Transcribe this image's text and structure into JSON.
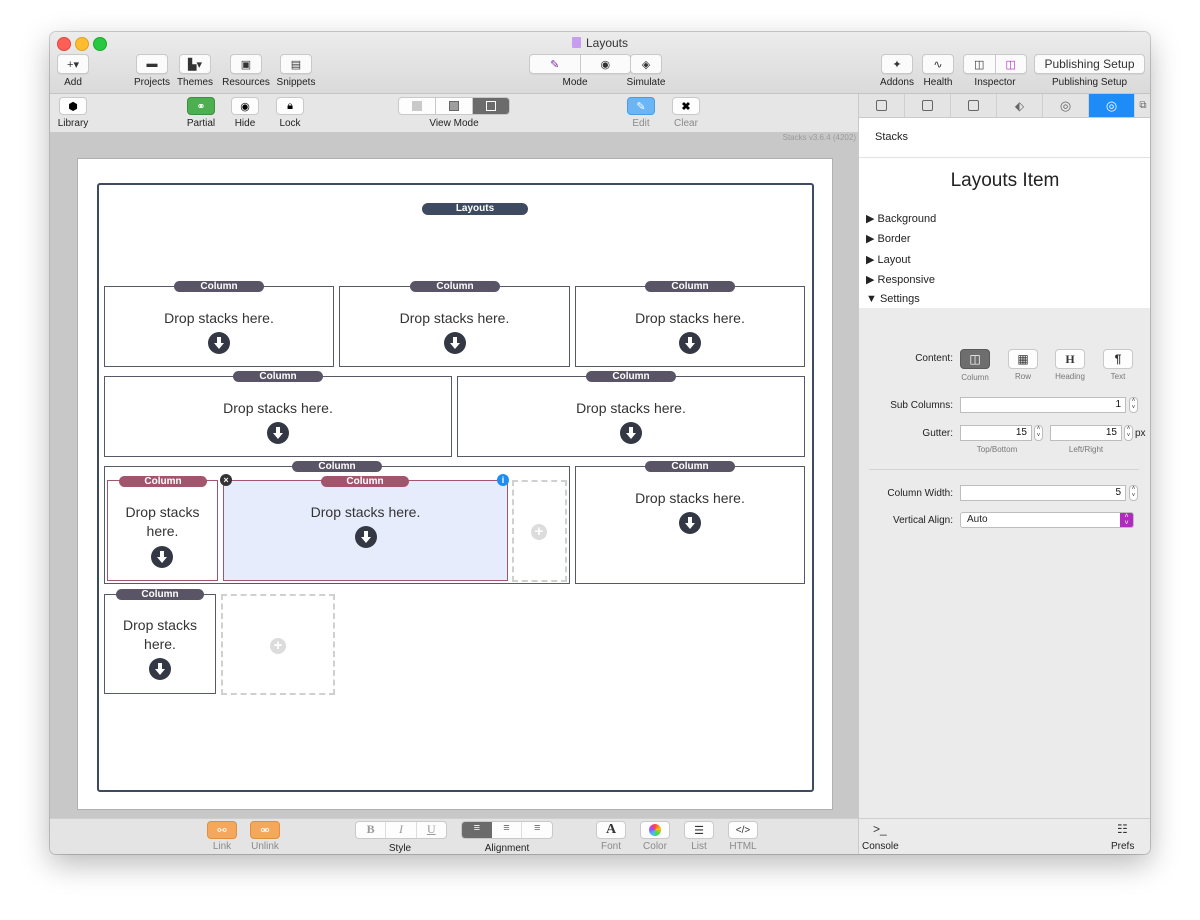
{
  "window": {
    "title": "Layouts"
  },
  "toolbar": {
    "add": "Add",
    "projects": "Projects",
    "themes": "Themes",
    "resources": "Resources",
    "snippets": "Snippets",
    "mode": "Mode",
    "simulate": "Simulate",
    "addons": "Addons",
    "health": "Health",
    "inspector": "Inspector",
    "publishing_setup": "Publishing Setup",
    "publishing_setup_label": "Publishing Setup"
  },
  "toolbar2": {
    "library": "Library",
    "partial": "Partial",
    "hide": "Hide",
    "lock": "Lock",
    "view_mode": "View Mode",
    "edit": "Edit",
    "clear": "Clear"
  },
  "canvas": {
    "version": "Stacks v3.6.4 (4202)",
    "layouts_label": "Layouts",
    "column_label": "Column",
    "drop_text": "Drop stacks here.",
    "drop_text_line1": "Drop stacks",
    "drop_text_line2": "here."
  },
  "inspector": {
    "section": "Stacks",
    "title": "Layouts Item",
    "groups": [
      "Background",
      "Border",
      "Layout",
      "Responsive",
      "Settings"
    ],
    "content_label": "Content:",
    "content_options": [
      "Column",
      "Row",
      "Heading",
      "Text"
    ],
    "content_selected": "Column",
    "sub_columns_label": "Sub Columns:",
    "sub_columns_value": "1",
    "gutter_label": "Gutter:",
    "gutter_top_bottom": "15",
    "gutter_left_right": "15",
    "gutter_unit": "px",
    "top_bottom_caption": "Top/Bottom",
    "left_right_caption": "Left/Right",
    "column_width_label": "Column Width:",
    "column_width_value": "5",
    "vertical_align_label": "Vertical Align:",
    "vertical_align_value": "Auto"
  },
  "bottom": {
    "link": "Link",
    "unlink": "Unlink",
    "style": "Style",
    "alignment": "Alignment",
    "font": "Font",
    "color": "Color",
    "list": "List",
    "html": "HTML",
    "console": "Console",
    "prefs": "Prefs"
  },
  "colors": {
    "accent": "#1e8cf7",
    "layouts": "#3d4a60",
    "column_label": "#5a5566",
    "column_label_selected": "#a1566d",
    "partial_green": "#4caf50",
    "link_orange": "#f5a85c"
  }
}
